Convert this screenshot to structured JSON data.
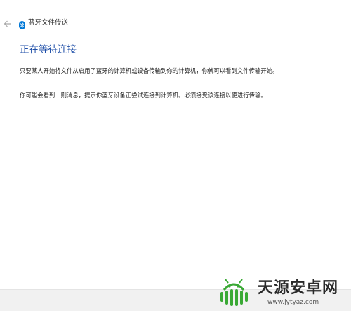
{
  "window": {
    "title": "蓝牙文件传送",
    "back_icon": "back-arrow-icon",
    "bluetooth_icon": "bluetooth-icon",
    "minimize_icon": "minimize-icon"
  },
  "main": {
    "heading": "正在等待连接",
    "paragraphs": [
      "只要某人开始将文件从启用了蓝牙的计算机或设备传输到你的计算机，你就可以看到文件传输开始。",
      "你可能会看到一则消息，提示你蓝牙设备正尝试连接到计算机。必须接受该连接以便进行传输。"
    ]
  },
  "watermark": {
    "name": "天源安卓网",
    "url": "www.jytyaz.com",
    "logo_icon": "android-logo-icon"
  },
  "colors": {
    "heading": "#1f4fa8",
    "bluetooth": "#0078d7",
    "logo": "#3aa935"
  }
}
